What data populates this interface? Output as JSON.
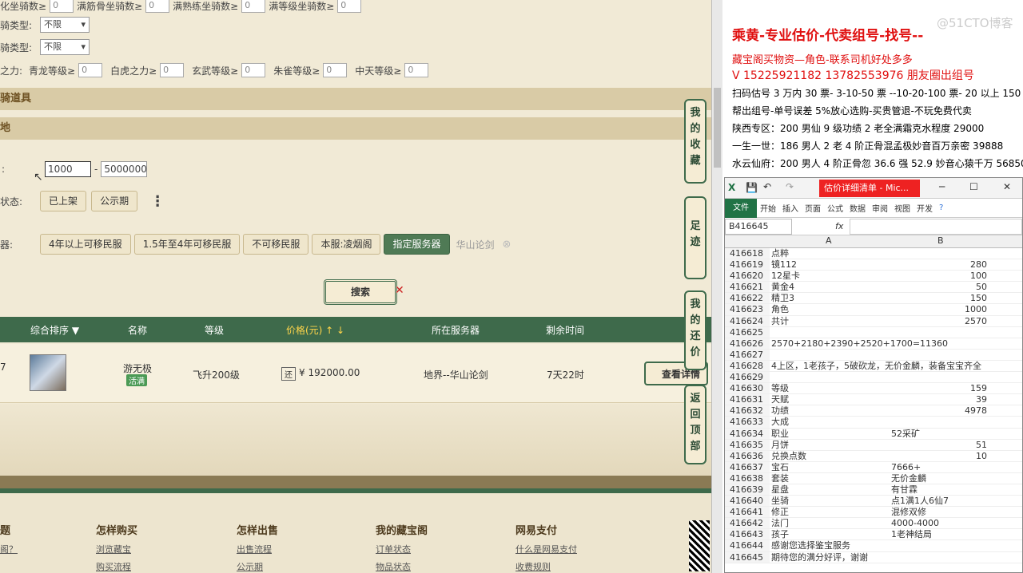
{
  "filters": {
    "row1": [
      {
        "label": "化坐骑数≥",
        "value": "0"
      },
      {
        "label": "满筋骨坐骑数≥",
        "value": "0"
      },
      {
        "label": "满熟练坐骑数≥",
        "value": "0"
      },
      {
        "label": "满等级坐骑数≥",
        "value": "0"
      }
    ],
    "type1_label": "骑类型:",
    "type1_value": "不限",
    "type2_label": "骑类型:",
    "type2_value": "不限",
    "power_label": "之力:",
    "row4": [
      {
        "label": "青龙等级≥",
        "value": "0"
      },
      {
        "label": "白虎之力≥",
        "value": "0"
      },
      {
        "label": "玄武等级≥",
        "value": "0"
      },
      {
        "label": "朱雀等级≥",
        "value": "0"
      },
      {
        "label": "中天等级≥",
        "value": "0"
      }
    ],
    "section1": "骑道具",
    "section2": "地",
    "price_min": "1000",
    "price_sep": "-",
    "price_max": "5000000",
    "status_label": "状态:",
    "status_options": [
      "已上架",
      "公示期"
    ],
    "more_icon": "⋮",
    "server_label": "器:",
    "server_options": [
      "4年以上可移民服",
      "1.5年至4年可移民服",
      "不可移民服",
      "本服:凌烟阁",
      "指定服务器"
    ],
    "server_selected": "华山论剑",
    "search_button": "搜索"
  },
  "table": {
    "headers": {
      "sort": "综合排序 ▼",
      "name": "名称",
      "level": "等级",
      "price": "价格(元) ↑ ↓",
      "server": "所在服务器",
      "time": "剩余时间"
    },
    "row": {
      "name": "游无极",
      "badge": "活满",
      "level": "飞升200级",
      "price_tag": "还",
      "price": "¥ 192000.00",
      "server": "地界--华山论剑",
      "time": "7天22时",
      "view": "查看详情",
      "left_mark": "7"
    }
  },
  "side_buttons": [
    "我的收藏",
    "足迹",
    "我的还价",
    "返回顶部"
  ],
  "footer": {
    "columns": [
      {
        "title": "题",
        "links": [
          "阁？"
        ]
      },
      {
        "title": "怎样购买",
        "links": [
          "浏览藏宝",
          "购买流程"
        ]
      },
      {
        "title": "怎样出售",
        "links": [
          "出售流程",
          "公示期"
        ]
      },
      {
        "title": "我的藏宝阁",
        "links": [
          "订单状态",
          "物品状态"
        ]
      },
      {
        "title": "网易支付",
        "links": [
          "什么是网易支付",
          "收费规则"
        ]
      }
    ]
  },
  "ad": {
    "title": "乘黄-专业估价-代卖组号-找号--",
    "lines": [
      "藏宝阁买物资—角色-联系司机好处多多",
      "V 15225921182   13782553976 朋友圈出组号",
      "扫码估号 3 万内 30 票- 3-10-50 票  --10-20-100 票- 20 以上 150",
      "帮出组号-单号误差 5%放心选购-买贵管退-不玩免费代卖",
      "陕西专区：200 男仙 9 级功绩 2 老全满霜克水程度 29000",
      "一生一世：186 男人 2 老 4 阶正骨混孟极妙音百万亲密 39888",
      "水云仙府：200 男人 4 阶正骨忽 36.6 强 52.9 妙音心猿千万 56850"
    ],
    "watermark": "@51CTO博客"
  },
  "excel": {
    "title": "估价详细清单 - Mic...",
    "tabs": [
      "文件",
      "开始",
      "插入",
      "页面",
      "公式",
      "数据",
      "审阅",
      "视图",
      "开发"
    ],
    "namebox": "B416645",
    "fx": "fx",
    "col_a": "A",
    "col_b": "B",
    "rows": [
      {
        "n": "416618",
        "a": "点粹",
        "b": ""
      },
      {
        "n": "416619",
        "a": "镜112",
        "b": "280"
      },
      {
        "n": "416620",
        "a": "12星卡",
        "b": "100"
      },
      {
        "n": "416621",
        "a": "黄金4",
        "b": "50"
      },
      {
        "n": "416622",
        "a": "精卫3",
        "b": "150"
      },
      {
        "n": "416623",
        "a": "角色",
        "b": "1000"
      },
      {
        "n": "416624",
        "a": "共计",
        "b": "2570"
      },
      {
        "n": "416625",
        "a": "",
        "b": ""
      },
      {
        "n": "416626",
        "a": "2570+2180+2390+2520+1700=11360",
        "b": ""
      },
      {
        "n": "416627",
        "a": "",
        "b": ""
      },
      {
        "n": "416628",
        "a": "4上区，1老孩子，5破砍龙，无价金麟，装备宝宝齐全",
        "b": ""
      },
      {
        "n": "416629",
        "a": "",
        "b": ""
      },
      {
        "n": "416630",
        "a": "等级",
        "b": "159"
      },
      {
        "n": "416631",
        "a": "天赋",
        "b": "39"
      },
      {
        "n": "416632",
        "a": "功绩",
        "b": "4978"
      },
      {
        "n": "416633",
        "a": "大成",
        "b": ""
      },
      {
        "n": "416634",
        "a": "职业",
        "bl": "52采矿"
      },
      {
        "n": "416635",
        "a": "月饼",
        "b": "51"
      },
      {
        "n": "416636",
        "a": "兑换点数",
        "b": "10"
      },
      {
        "n": "416637",
        "a": "宝石",
        "bl": "7666+"
      },
      {
        "n": "416638",
        "a": "套装",
        "bl": "无价金麟"
      },
      {
        "n": "416639",
        "a": "星盘",
        "bl": "有甘霖"
      },
      {
        "n": "416640",
        "a": "坐骑",
        "bl": "点1满1人6仙7"
      },
      {
        "n": "416641",
        "a": "修正",
        "bl": "混修双修"
      },
      {
        "n": "416642",
        "a": "法门",
        "bl": "4000-4000"
      },
      {
        "n": "416643",
        "a": "孩子",
        "bl": "1老神结局"
      },
      {
        "n": "416644",
        "a": "感谢您选择鉴宝服务",
        "b": ""
      },
      {
        "n": "416645",
        "a": "期待您的满分好评，谢谢",
        "b": ""
      }
    ]
  }
}
